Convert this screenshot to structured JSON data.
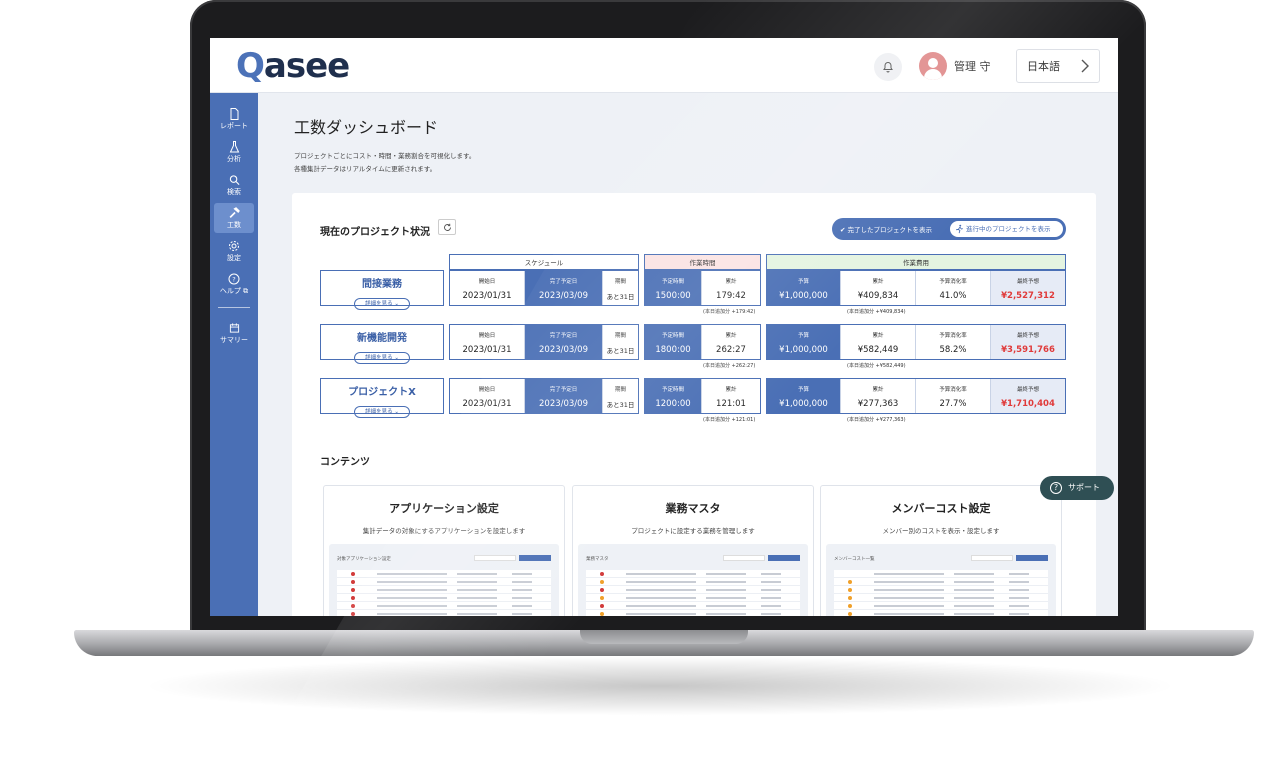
{
  "header": {
    "logo_q": "Q",
    "logo_rest": "asee",
    "user_name": "管理 守",
    "language": "日本語"
  },
  "sidebar": {
    "items": [
      {
        "label": "レポート",
        "icon": "document-icon"
      },
      {
        "label": "分析",
        "icon": "flask-icon"
      },
      {
        "label": "検索",
        "icon": "search-icon"
      },
      {
        "label": "工数",
        "icon": "hammer-icon",
        "active": true
      },
      {
        "label": "設定",
        "icon": "gear-icon"
      },
      {
        "label": "ヘルプ",
        "icon": "help-icon"
      },
      {
        "label": "サマリー",
        "icon": "calendar-icon"
      }
    ]
  },
  "page": {
    "title": "工数ダッシュボード",
    "desc1": "プロジェクトごとにコスト・時間・業務割合を可視化します。",
    "desc2": "各種集計データはリアルタイムに更新されます。"
  },
  "status": {
    "title": "現在のプロジェクト状況",
    "toggle_done": "完了したプロジェクトを表示",
    "toggle_active": "進行中のプロジェクトを表示",
    "group_schedule": "スケジュール",
    "group_hours": "作業時間",
    "group_cost": "作業費用",
    "labels": {
      "start": "開始日",
      "end": "完了予定日",
      "period": "期間",
      "planned_hours": "予定時間",
      "total": "累計",
      "budget": "予算",
      "cost_total": "累計",
      "consumption": "予算消化率",
      "final_forecast": "最終予想"
    },
    "detail_label": "詳細を見る",
    "projects": [
      {
        "name": "間接業務",
        "start": "2023/01/31",
        "end": "2023/03/09",
        "period": "あと31日",
        "planned_hours": "1500:00",
        "total_hours": "179:42",
        "hours_note": "(本日追加分 +179:42)",
        "budget": "¥1,000,000",
        "cost_total": "¥409,834",
        "cost_note": "(本日追加分 +¥409,834)",
        "consumption": "41.0%",
        "forecast": "¥2,527,312"
      },
      {
        "name": "新機能開発",
        "start": "2023/01/31",
        "end": "2023/03/09",
        "period": "あと31日",
        "planned_hours": "1800:00",
        "total_hours": "262:27",
        "hours_note": "(本日追加分 +262:27)",
        "budget": "¥1,000,000",
        "cost_total": "¥582,449",
        "cost_note": "(本日追加分 +¥582,449)",
        "consumption": "58.2%",
        "forecast": "¥3,591,766"
      },
      {
        "name": "プロジェクトX",
        "start": "2023/01/31",
        "end": "2023/03/09",
        "period": "あと31日",
        "planned_hours": "1200:00",
        "total_hours": "121:01",
        "hours_note": "(本日追加分 +121:01)",
        "budget": "¥1,000,000",
        "cost_total": "¥277,363",
        "cost_note": "(本日追加分 +¥277,363)",
        "consumption": "27.7%",
        "forecast": "¥1,710,404"
      }
    ]
  },
  "contents": {
    "title": "コンテンツ",
    "cards": [
      {
        "title": "アプリケーション設定",
        "desc": "集計データの対象にするアプリケーションを設定します",
        "mini_title": "対象アプリケーション設定"
      },
      {
        "title": "業務マスタ",
        "desc": "プロジェクトに設定する業務を管理します",
        "mini_title": "業務マスタ"
      },
      {
        "title": "メンバーコスト設定",
        "desc": "メンバー別のコストを表示・設定します",
        "mini_title": "メンバーコスト一覧"
      }
    ]
  },
  "support": {
    "label": "サポート"
  },
  "colors": {
    "brand": "#4a6fb5",
    "alert": "#e03a3a",
    "support": "#2f4f54"
  }
}
